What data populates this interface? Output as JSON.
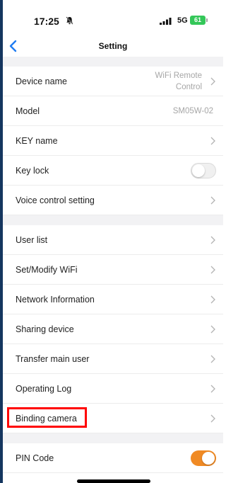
{
  "status_bar": {
    "time": "17:25",
    "network": "5G",
    "battery": "61"
  },
  "header": {
    "title": "Setting",
    "back_icon": "chevron-left-icon"
  },
  "sections": [
    {
      "rows": [
        {
          "label": "Device name",
          "value_lines": [
            "WiFi Remote",
            "Control"
          ],
          "chevron": true
        },
        {
          "label": "Model",
          "value": "SM05W-02",
          "chevron": false
        },
        {
          "label": "KEY name",
          "chevron": true
        },
        {
          "label": "Key lock",
          "toggle": false
        },
        {
          "label": "Voice control setting",
          "chevron": true
        }
      ]
    },
    {
      "rows": [
        {
          "label": "User list",
          "chevron": true
        },
        {
          "label": "Set/Modify WiFi",
          "chevron": true
        },
        {
          "label": "Network Information",
          "chevron": true
        },
        {
          "label": "Sharing device",
          "chevron": true
        },
        {
          "label": "Transfer main user",
          "chevron": true
        },
        {
          "label": "Operating Log",
          "chevron": true
        },
        {
          "label": "Binding camera",
          "chevron": true,
          "highlighted": true
        }
      ]
    },
    {
      "rows": [
        {
          "label": "PIN Code",
          "toggle": true
        }
      ]
    }
  ],
  "colors": {
    "accent": "#f08a24",
    "highlight": "#ff0000",
    "back_arrow": "#1f7cf2",
    "battery": "#34c759",
    "section_gap": "#f2f2f4"
  }
}
